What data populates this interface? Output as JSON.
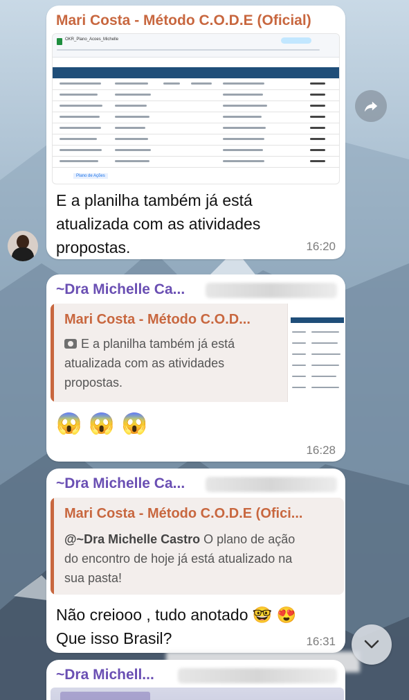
{
  "colors": {
    "sender_orange": "#c8673f",
    "sender_purple": "#6a4fb3",
    "bubble": "#ffffff",
    "quote_bg": "#f3eeec",
    "time": "#7c7c7c"
  },
  "messages": [
    {
      "sender": "Mari Costa - Método C.O.D.E (Oficial)",
      "image": {
        "file_title": "OKR_Plano_Acoes_Michelle",
        "tab": "Plano de Ações",
        "description": "spreadsheet-screenshot"
      },
      "text_lines": [
        "E a planilha também já está",
        "atualizada com as atividades",
        "propostas."
      ],
      "time": "16:20",
      "icons": [
        "avatar",
        "forward-icon"
      ]
    },
    {
      "sender": "~Dra Michelle Ca...",
      "quote": {
        "sender": "Mari Costa - Método C.O.D...",
        "text_lines": [
          "E a planilha também já está",
          "atualizada com as atividades",
          "propostas."
        ],
        "icon": "camera-icon"
      },
      "reactions_emoji": [
        "😱",
        "😱",
        "😱"
      ],
      "time": "16:28"
    },
    {
      "sender": "~Dra Michelle Ca...",
      "quote": {
        "sender": "Mari Costa - Método C.O.D.E (Ofici...",
        "mention": "@~Dra Michelle Castro",
        "text_after_mention": " O plano de ação",
        "text_lines": [
          "do encontro de hoje já está atualizado na",
          "sua pasta!"
        ]
      },
      "text_lines": [
        "Não creiooo , tudo anotado 🤓 😍",
        "Que isso Brasil?"
      ],
      "time": "16:31"
    },
    {
      "sender": "~Dra Michell..."
    }
  ],
  "controls": {
    "scroll_down_icon": "chevron-down-icon"
  }
}
